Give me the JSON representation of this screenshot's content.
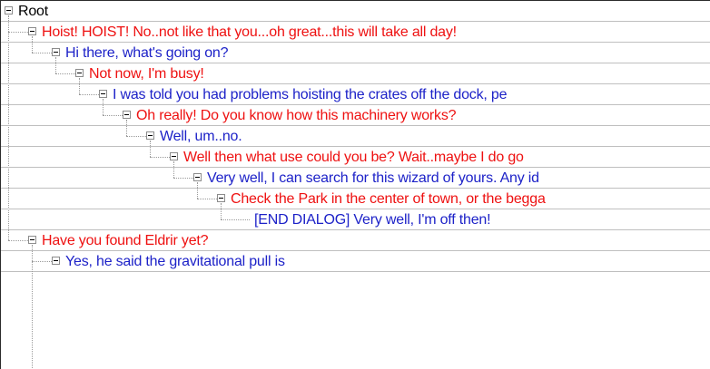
{
  "colors": {
    "npc": "#ee1111",
    "player": "#1d22c8",
    "root": "#000000",
    "row_divider": "#bfbfbf"
  },
  "nodes": [
    {
      "text": "Root",
      "level": 0,
      "color": "root",
      "has_children": true
    },
    {
      "text": "Hoist! HOIST! No..not like that you...oh great...this will take all day!",
      "level": 1,
      "color": "npc",
      "has_children": true
    },
    {
      "text": "Hi there, what's going on?",
      "level": 2,
      "color": "player",
      "has_children": true
    },
    {
      "text": "Not now, I'm busy!",
      "level": 3,
      "color": "npc",
      "has_children": true
    },
    {
      "text": "I was told you had problems hoisting the crates off the dock, pe",
      "level": 4,
      "color": "player",
      "has_children": true
    },
    {
      "text": "Oh really! Do you know how this machinery works?",
      "level": 5,
      "color": "npc",
      "has_children": true
    },
    {
      "text": "Well, um..no.",
      "level": 6,
      "color": "player",
      "has_children": true
    },
    {
      "text": "Well then what use could you be? Wait..maybe I do go",
      "level": 7,
      "color": "npc",
      "has_children": true
    },
    {
      "text": "Very well, I can search for this wizard of yours. Any id",
      "level": 8,
      "color": "player",
      "has_children": true
    },
    {
      "text": "Check the Park in the center of town, or the begga",
      "level": 9,
      "color": "npc",
      "has_children": true
    },
    {
      "text": "[END DIALOG] Very well, I'm off then!",
      "level": 10,
      "color": "player",
      "has_children": false
    },
    {
      "text": "Have you found Eldrir yet?",
      "level": 1,
      "color": "npc",
      "has_children": true
    },
    {
      "text": "Yes, he said the gravitational pull is",
      "level": 2,
      "color": "player",
      "has_children": true
    }
  ]
}
